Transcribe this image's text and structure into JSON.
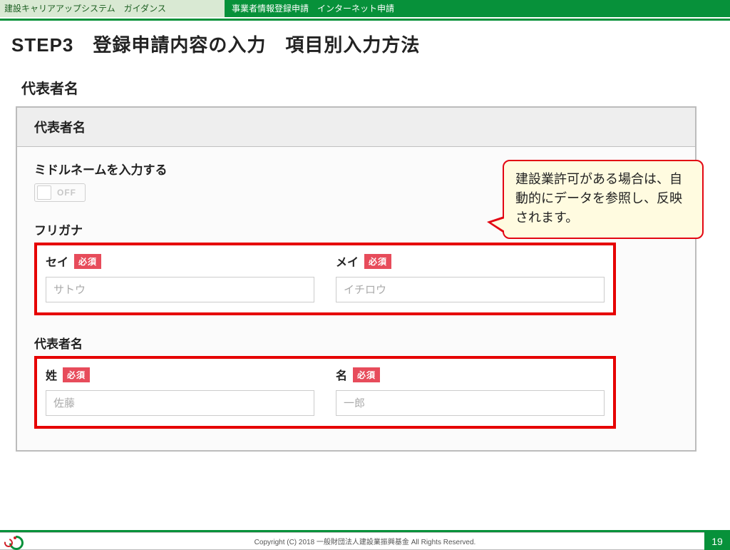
{
  "header": {
    "left": "建設キャリアアップシステム　ガイダンス",
    "right": "事業者情報登録申請　インターネット申請"
  },
  "step_title": "STEP3　登録申請内容の入力　項目別入力方法",
  "section_heading": "代表者名",
  "panel": {
    "title": "代表者名",
    "middle_name_label": "ミドルネームを入力する",
    "toggle_state_label": "OFF",
    "furigana": {
      "group_label": "フリガナ",
      "sei_label": "セイ",
      "mei_label": "メイ",
      "sei_placeholder": "サトウ",
      "mei_placeholder": "イチロウ"
    },
    "name": {
      "group_label": "代表者名",
      "sei_label": "姓",
      "mei_label": "名",
      "sei_placeholder": "佐藤",
      "mei_placeholder": "一郎"
    },
    "required_badge": "必須"
  },
  "callout": "建設業許可がある場合は、自動的にデータを参照し、反映されます。",
  "footer": {
    "copyright": "Copyright (C) 2018 一般財団法人建設業振興基金 All Rights Reserved.",
    "page_number": "19"
  }
}
